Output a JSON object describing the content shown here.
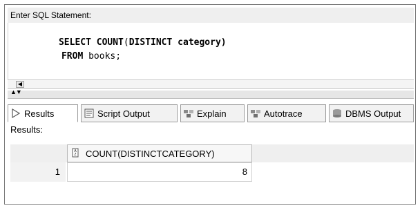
{
  "prompt": {
    "label": "Enter SQL Statement:"
  },
  "editor": {
    "lines": [
      {
        "kw1": "SELECT COUNT",
        "rest1": "(",
        "kw2": "DISTINCT",
        "rest2": " category)"
      },
      {
        "kw1": "FROM",
        "rest1": " books;"
      }
    ]
  },
  "tabs": [
    {
      "label": "Results",
      "icon": "play-icon"
    },
    {
      "label": "Script Output",
      "icon": "script-output-icon"
    },
    {
      "label": "Explain",
      "icon": "explain-icon"
    },
    {
      "label": "Autotrace",
      "icon": "autotrace-icon"
    },
    {
      "label": "DBMS Output",
      "icon": "dbms-output-icon"
    }
  ],
  "results": {
    "label": "Results:",
    "column_header": "COUNT(DISTINCTCATEGORY)",
    "rows": [
      {
        "num": "1",
        "value": "8"
      }
    ]
  },
  "colors": {
    "tab_border": "#9a9a9a",
    "header_bg": "#efefef"
  }
}
